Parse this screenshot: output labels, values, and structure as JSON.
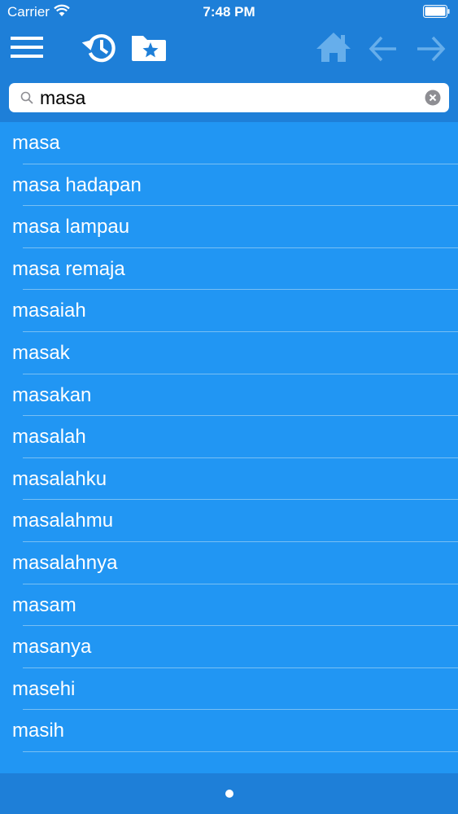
{
  "status_bar": {
    "carrier": "Carrier",
    "time": "7:48 PM"
  },
  "toolbar": {
    "icons": [
      "menu-icon",
      "history-icon",
      "favorites-folder-icon",
      "home-icon",
      "back-arrow-icon",
      "forward-arrow-icon"
    ],
    "colors": {
      "header_bg": "#1e7fd8",
      "active_icon": "#ffffff",
      "inactive_icon": "#66aeeb"
    }
  },
  "search": {
    "value": "masa",
    "placeholder": ""
  },
  "results": {
    "background": "#2196f3",
    "items": [
      "masa",
      "masa hadapan",
      "masa lampau",
      "masa remaja",
      "masaiah",
      "masak",
      "masakan",
      "masalah",
      "masalahku",
      "masalahmu",
      "masalahnya",
      "masam",
      "masanya",
      "masehi",
      "masih"
    ]
  },
  "pager": {
    "pages": 1,
    "current": 1
  }
}
